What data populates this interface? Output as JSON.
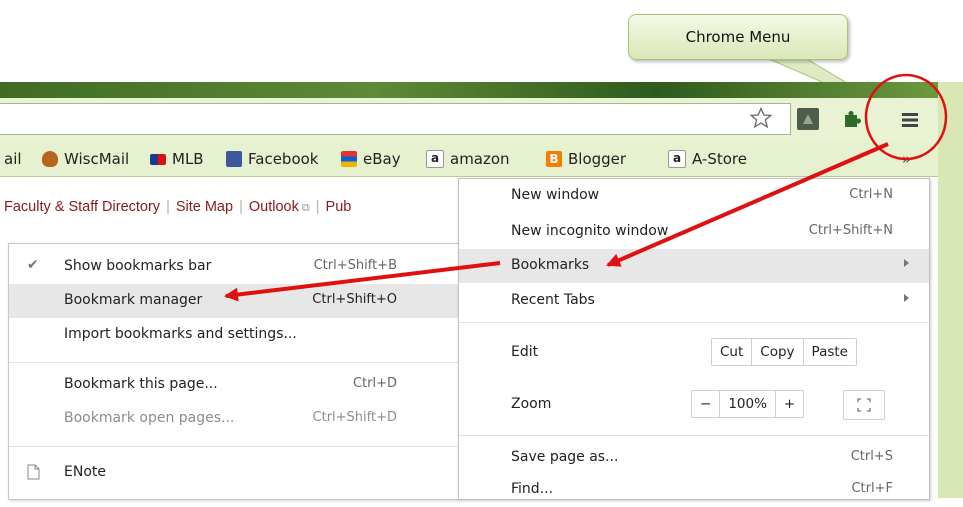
{
  "callout": {
    "text": "Chrome Menu"
  },
  "bookmarks_bar": {
    "items": [
      {
        "label": "ail",
        "color": "#333333"
      },
      {
        "label": "WiscMail",
        "color": "#b5651d"
      },
      {
        "label": "MLB",
        "color": "#1b3a8c"
      },
      {
        "label": "Facebook",
        "color": "#3b5998"
      },
      {
        "label": "eBay",
        "color": "#e53238"
      },
      {
        "label": "amazon",
        "color": "#111111"
      },
      {
        "label": "Blogger",
        "color": "#f57d00"
      },
      {
        "label": "A-Store",
        "color": "#111111"
      }
    ],
    "overflow": "»"
  },
  "page_links": {
    "items": [
      "Faculty & Staff Directory",
      "Site Map",
      "Outlook",
      "Pub"
    ]
  },
  "bookmarks_submenu": {
    "items": [
      {
        "label": "Show bookmarks bar",
        "shortcut": "Ctrl+Shift+B",
        "checked": "✔"
      },
      {
        "label": "Bookmark manager",
        "shortcut": "Ctrl+Shift+O"
      },
      {
        "label": "Import bookmarks and settings..."
      },
      {
        "label": "Bookmark this page...",
        "shortcut": "Ctrl+D"
      },
      {
        "label": "Bookmark open pages...",
        "shortcut": "Ctrl+Shift+D"
      },
      {
        "label": "ENote"
      }
    ]
  },
  "chrome_menu": {
    "new_window": {
      "label": "New window",
      "shortcut": "Ctrl+N"
    },
    "new_incognito": {
      "label": "New incognito window",
      "shortcut": "Ctrl+Shift+N"
    },
    "bookmarks": {
      "label": "Bookmarks"
    },
    "recent_tabs": {
      "label": "Recent Tabs"
    },
    "edit": {
      "label": "Edit",
      "cut": "Cut",
      "copy": "Copy",
      "paste": "Paste"
    },
    "zoom": {
      "label": "Zoom",
      "minus": "−",
      "value": "100%",
      "plus": "+"
    },
    "save_page": {
      "label": "Save page as...",
      "shortcut": "Ctrl+S"
    },
    "find": {
      "label": "Find...",
      "shortcut": "Ctrl+F"
    }
  },
  "colors": {
    "annotation_red": "#e01010",
    "menu_highlight": "#e7e7e7",
    "toolbar_green": "#e9f3d3"
  },
  "icons": [
    "star-icon",
    "extension-icon",
    "puzzle-icon",
    "hamburger-menu-icon",
    "check-icon",
    "page-icon",
    "fullscreen-icon"
  ]
}
